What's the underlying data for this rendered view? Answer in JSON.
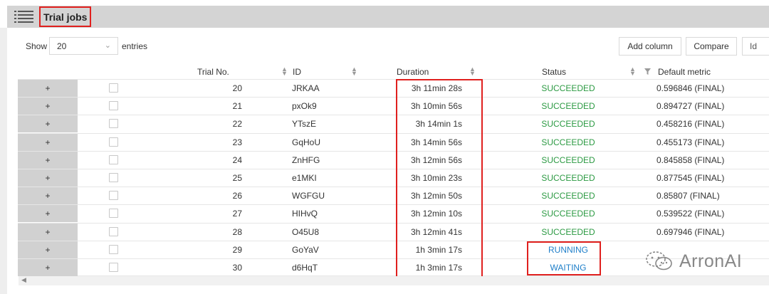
{
  "header": {
    "title": "Trial jobs",
    "menu_icon": "hamburger-list-icon"
  },
  "controls": {
    "show_label": "Show",
    "page_size": "20",
    "entries_label": "entries",
    "add_column_label": "Add column",
    "compare_label": "Compare",
    "search_placeholder": "Id"
  },
  "table": {
    "columns": {
      "trial_no": "Trial No.",
      "id": "ID",
      "duration": "Duration",
      "status": "Status",
      "metric": "Default metric"
    },
    "expand_symbol": "+",
    "rows": [
      {
        "trial": "20",
        "id": "JRKAA",
        "duration": "3h 11min 28s",
        "status": "SUCCEEDED",
        "metric": "0.596846 (FINAL)"
      },
      {
        "trial": "21",
        "id": "pxOk9",
        "duration": "3h 10min 56s",
        "status": "SUCCEEDED",
        "metric": "0.894727 (FINAL)"
      },
      {
        "trial": "22",
        "id": "YTszE",
        "duration": "3h 14min 1s",
        "status": "SUCCEEDED",
        "metric": "0.458216 (FINAL)"
      },
      {
        "trial": "23",
        "id": "GqHoU",
        "duration": "3h 14min 56s",
        "status": "SUCCEEDED",
        "metric": "0.455173 (FINAL)"
      },
      {
        "trial": "24",
        "id": "ZnHFG",
        "duration": "3h 12min 56s",
        "status": "SUCCEEDED",
        "metric": "0.845858 (FINAL)"
      },
      {
        "trial": "25",
        "id": "e1MKI",
        "duration": "3h 10min 23s",
        "status": "SUCCEEDED",
        "metric": "0.877545 (FINAL)"
      },
      {
        "trial": "26",
        "id": "WGFGU",
        "duration": "3h 12min 50s",
        "status": "SUCCEEDED",
        "metric": "0.85807 (FINAL)"
      },
      {
        "trial": "27",
        "id": "HIHvQ",
        "duration": "3h 12min 10s",
        "status": "SUCCEEDED",
        "metric": "0.539522 (FINAL)"
      },
      {
        "trial": "28",
        "id": "O45U8",
        "duration": "3h 12min 41s",
        "status": "SUCCEEDED",
        "metric": "0.697946 (FINAL)"
      },
      {
        "trial": "29",
        "id": "GoYaV",
        "duration": "1h 3min 17s",
        "status": "RUNNING",
        "metric": ""
      },
      {
        "trial": "30",
        "id": "d6HqT",
        "duration": "1h 3min 17s",
        "status": "WAITING",
        "metric": ""
      }
    ]
  },
  "watermark": {
    "text": "ArronAI",
    "icon": "wechat-logo-icon"
  },
  "colors": {
    "succeeded": "#2c9a43",
    "running": "#1f7fc9",
    "highlight": "#e0201e"
  }
}
